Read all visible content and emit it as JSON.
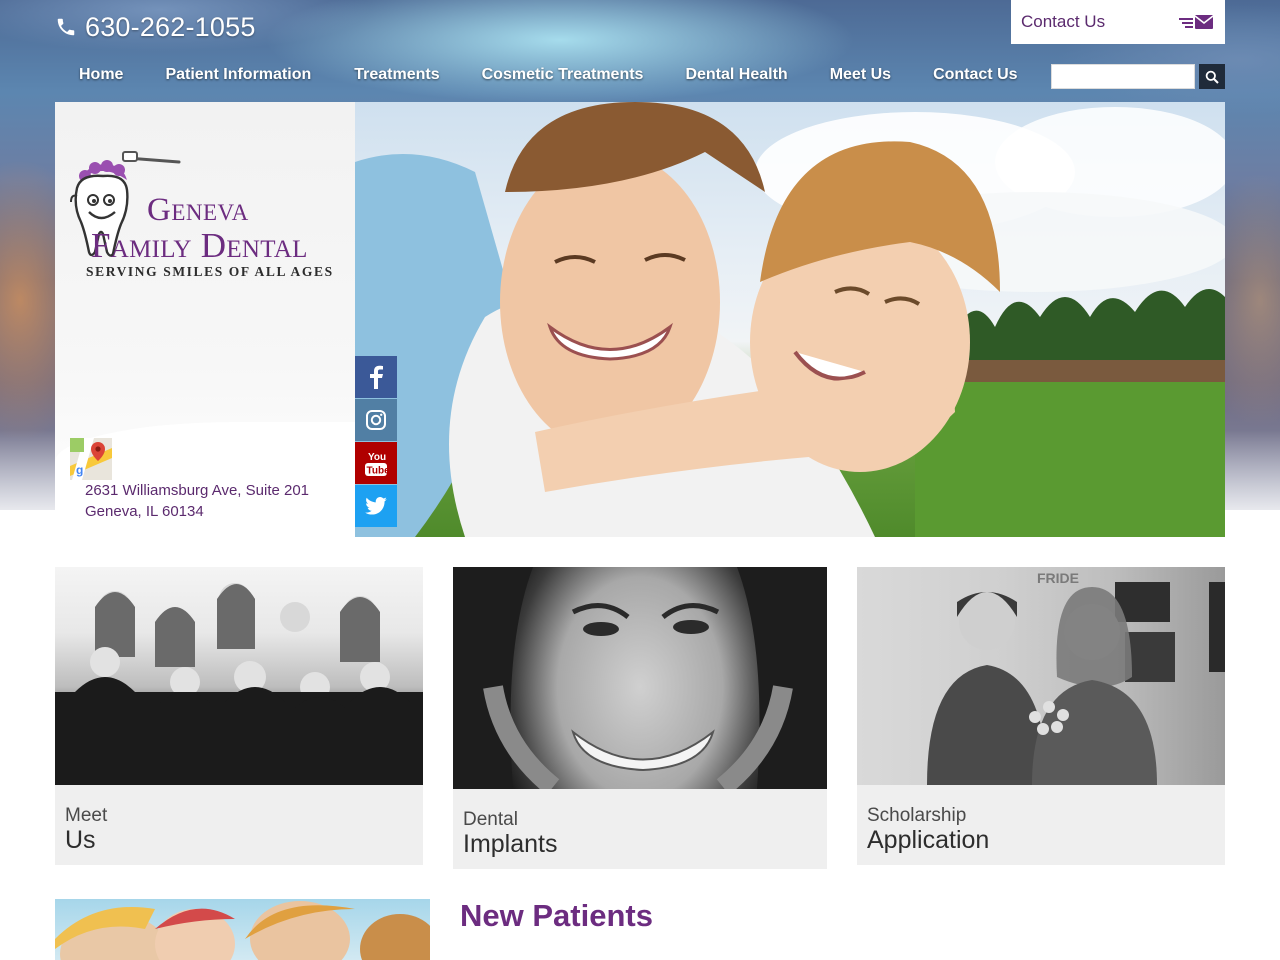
{
  "header": {
    "phone": "630-262-1055",
    "contact_box_label": "Contact Us"
  },
  "nav": {
    "items": [
      {
        "label": "Home"
      },
      {
        "label": "Patient Information"
      },
      {
        "label": "Treatments"
      },
      {
        "label": "Cosmetic Treatments"
      },
      {
        "label": "Dental Health"
      },
      {
        "label": "Meet Us"
      },
      {
        "label": "Contact Us"
      }
    ],
    "search_placeholder": ""
  },
  "brand": {
    "line1": "Geneva",
    "line2": "Family Dental",
    "tagline": "SERVING SMILES OF ALL AGES"
  },
  "address": {
    "line1": "2631 Williamsburg Ave, Suite 201",
    "line2": "Geneva, IL 60134"
  },
  "social": [
    {
      "name": "facebook",
      "color": "#3b5998"
    },
    {
      "name": "instagram",
      "color": "#517fa4"
    },
    {
      "name": "youtube",
      "color": "#b00000"
    },
    {
      "name": "twitter",
      "color": "#1da1f2"
    }
  ],
  "cards": [
    {
      "small": "Meet",
      "big": "Us"
    },
    {
      "small": "Dental",
      "big": "Implants"
    },
    {
      "small": "Scholarship",
      "big": "Application"
    }
  ],
  "section_heading": "New Patients",
  "colors": {
    "brand_purple": "#6c2c80",
    "nav_dark": "#1f2b3a"
  }
}
